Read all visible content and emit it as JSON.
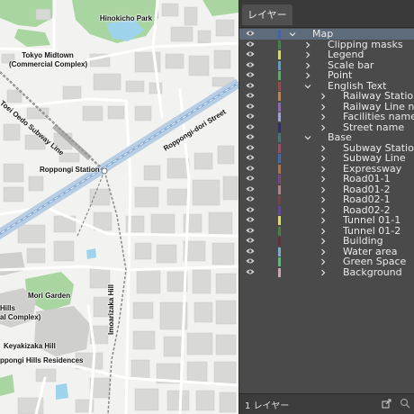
{
  "map": {
    "labels": {
      "hinokicho_park": "Hinokicho Park",
      "tokyo_midtown_1": "Tokyo Midtown",
      "tokyo_midtown_2": "(Commercial Complex)",
      "toei_oedo_line": "Toei Oedo Subway Line",
      "roppongi_dori": "Roppongi-dori Street",
      "roppongi_station": "Roppongi Station",
      "imoarizaka_hill": "Imoarizaka Hill",
      "mori_garden": "Mori Garden",
      "hills_1": "Hills",
      "hills_2": "al Complex)",
      "keyakizaka_hill": "Keyakizaka Hill",
      "roppongi_hills_residences": "ppongi Hills Residences"
    }
  },
  "panel": {
    "tab_title": "レイヤー",
    "footer_count": "1 レイヤー",
    "layers": [
      {
        "name": "Map",
        "level": 0,
        "expanded": true,
        "selected": true,
        "color": "#3a5fd9"
      },
      {
        "name": "Clipping masks",
        "level": 1,
        "expanded": false,
        "color": "#2f8f3a"
      },
      {
        "name": "Legend",
        "level": 1,
        "expanded": false,
        "color": "#d8e23c"
      },
      {
        "name": "Scale bar",
        "level": 1,
        "expanded": false,
        "color": "#4aa6d8"
      },
      {
        "name": "Point",
        "level": 1,
        "expanded": false,
        "color": "#3bc14f"
      },
      {
        "name": "English Text",
        "level": 1,
        "expanded": true,
        "color": "#c33a3a"
      },
      {
        "name": "Railway Station",
        "level": 2,
        "expanded": false,
        "color": "#e07a2a"
      },
      {
        "name": "Railway Line name",
        "level": 2,
        "expanded": false,
        "color": "#9b5ad6"
      },
      {
        "name": "Facilities name",
        "level": 2,
        "expanded": false,
        "color": "#9aa0e8"
      },
      {
        "name": "Street name",
        "level": 2,
        "expanded": false,
        "color": "#1f2f8a"
      },
      {
        "name": "Base",
        "level": 1,
        "expanded": true,
        "color": "#2f7f7a"
      },
      {
        "name": "Subway Station",
        "level": 2,
        "expanded": false,
        "color": "#c23a6a"
      },
      {
        "name": "Subway Line",
        "level": 2,
        "expanded": false,
        "color": "#2e6fd6"
      },
      {
        "name": "Expressway",
        "level": 2,
        "expanded": false,
        "color": "#d06a2a"
      },
      {
        "name": "Road01-1",
        "level": 2,
        "expanded": false,
        "color": "#8a3a9a"
      },
      {
        "name": "Road01-2",
        "level": 2,
        "expanded": false,
        "color": "#c77a7a"
      },
      {
        "name": "Road02-1",
        "level": 2,
        "expanded": false,
        "color": "#8a3a3a"
      },
      {
        "name": "Road02-2",
        "level": 2,
        "expanded": false,
        "color": "#6a3ac2"
      },
      {
        "name": "Tunnel 01-1",
        "level": 2,
        "expanded": false,
        "color": "#e6e23a"
      },
      {
        "name": "Tunnel 01-2",
        "level": 2,
        "expanded": false,
        "color": "#3a8a3a"
      },
      {
        "name": "Building",
        "level": 2,
        "expanded": false,
        "color": "#7a2a2a"
      },
      {
        "name": "Water area",
        "level": 2,
        "expanded": false,
        "color": "#6ab0e0"
      },
      {
        "name": "Green Space",
        "level": 2,
        "expanded": false,
        "color": "#3ad06a"
      },
      {
        "name": "Background",
        "level": 2,
        "expanded": false,
        "color": "#d8a0b0"
      }
    ]
  }
}
